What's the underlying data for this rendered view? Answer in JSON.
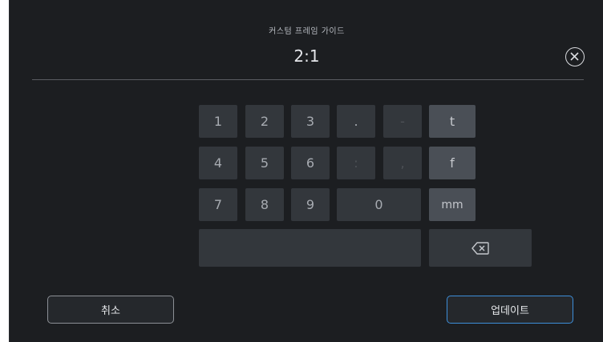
{
  "header": {
    "title": "커스텀 프레임 가이드",
    "value": "2:1"
  },
  "keypad": {
    "row1": [
      "1",
      "2",
      "3",
      ".",
      "-",
      "t"
    ],
    "row2": [
      "4",
      "5",
      "6",
      ":",
      ",",
      "f"
    ],
    "row3": [
      "7",
      "8",
      "9",
      "0",
      "mm"
    ]
  },
  "footer": {
    "cancel_label": "취소",
    "update_label": "업데이트"
  },
  "icons": {
    "close": "close-circle-icon",
    "backspace": "backspace-icon"
  },
  "colors": {
    "background": "#1c1e21",
    "key": "#33373c",
    "unit_key": "#4a4f56",
    "accent": "#3d8ed9"
  }
}
